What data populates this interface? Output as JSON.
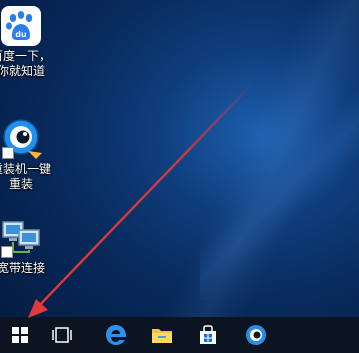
{
  "desktop": {
    "icons": [
      {
        "label": "百度一下，你就知道",
        "icon": "baidu-paw-icon"
      },
      {
        "label": "重装机一键重装",
        "icon": "reinstall-eye-icon"
      },
      {
        "label": "宽带连接",
        "icon": "network-computers-icon"
      }
    ]
  },
  "taskbar": {
    "buttons": [
      "start-icon",
      "task-view-icon",
      "edge-icon",
      "file-explorer-icon",
      "store-icon",
      "app-icon"
    ]
  },
  "colors": {
    "accent_blue": "#2b7de9",
    "arrow_red": "#e03a3a",
    "taskbar_bg": "#0c1422"
  }
}
